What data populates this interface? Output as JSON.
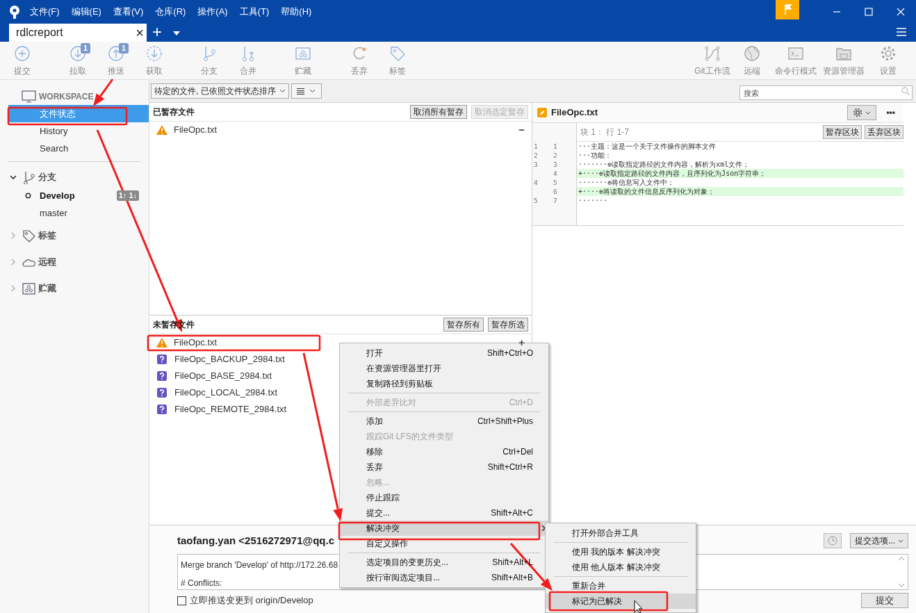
{
  "menu_bar": [
    "文件(F)",
    "编辑(E)",
    "查看(V)",
    "仓库(R)",
    "操作(A)",
    "工具(T)",
    "帮助(H)"
  ],
  "tab": {
    "label": "rdlcreport",
    "selected": true,
    "close": "×",
    "add": "+"
  },
  "toolbar_left": [
    {
      "label": "提交"
    },
    {
      "label": "拉取",
      "badge": "1"
    },
    {
      "label": "推送",
      "badge": "1"
    },
    {
      "label": "获取"
    },
    {
      "label": "分支"
    },
    {
      "label": "合并"
    },
    {
      "label": "贮藏"
    },
    {
      "label": "丢弃"
    },
    {
      "label": "标签"
    }
  ],
  "toolbar_right": [
    {
      "label": "Git工作流"
    },
    {
      "label": "远端"
    },
    {
      "label": "命令行模式"
    },
    {
      "label": "资源管理器"
    },
    {
      "label": "设置"
    }
  ],
  "sidebar": {
    "workspace": {
      "title": "WORKSPACE",
      "items": [
        {
          "label": "文件状态",
          "selected": true
        },
        {
          "label": "History",
          "selected": false
        },
        {
          "label": "Search",
          "selected": false
        }
      ]
    },
    "sections": [
      {
        "label": "分支",
        "expanded": true,
        "children": [
          {
            "label": "Develop",
            "current": true,
            "badge": "1↑ 1↓"
          },
          {
            "label": "master",
            "current": false
          }
        ]
      },
      {
        "label": "标签",
        "expanded": false
      },
      {
        "label": "远程",
        "expanded": false
      },
      {
        "label": "贮藏",
        "expanded": false
      }
    ]
  },
  "filter": {
    "label": "待定的文件, 已依照文件状态排序",
    "search_placeholder": "搜索"
  },
  "staged": {
    "title": "已暂存文件",
    "buttons": [
      {
        "label": "取消所有暂存",
        "disabled": false
      },
      {
        "label": "取消选定暂存",
        "disabled": true
      }
    ],
    "row_action": "−",
    "files": [
      {
        "name": "FileOpc.txt",
        "kind": "conflict"
      }
    ]
  },
  "unstaged": {
    "title": "未暂存文件",
    "buttons": [
      {
        "label": "暂存所有",
        "disabled": false
      },
      {
        "label": "暂存所选",
        "disabled": false
      }
    ],
    "row_action": "+",
    "files": [
      {
        "name": "FileOpc.txt",
        "kind": "conflict"
      },
      {
        "name": "FileOpc_BACKUP_2984.txt",
        "kind": "untracked"
      },
      {
        "name": "FileOpc_BASE_2984.txt",
        "kind": "untracked"
      },
      {
        "name": "FileOpc_LOCAL_2984.txt",
        "kind": "untracked"
      },
      {
        "name": "FileOpc_REMOTE_2984.txt",
        "kind": "untracked"
      }
    ]
  },
  "diff": {
    "file": "FileOpc.txt",
    "more": "•••",
    "hunk": "块 1： 行 1-7",
    "buttons": [
      "暂存区块",
      "丢弃区块"
    ],
    "lines": [
      {
        "old": "1",
        "new": "1",
        "kind": "context",
        "text": "···主题：这是一个关于文件操作的脚本文件"
      },
      {
        "old": "2",
        "new": "2",
        "kind": "context",
        "text": "···功能："
      },
      {
        "old": "3",
        "new": "3",
        "kind": "context",
        "text": "·······⊕读取指定路径的文件内容，解析为xml文件；"
      },
      {
        "new": "4",
        "kind": "added",
        "text": "+····⊕读取指定路径的文件内容，且序列化为Json字符串；"
      },
      {
        "old": "4",
        "new": "5",
        "kind": "context",
        "text": "·······⊕将信息写入文件中；"
      },
      {
        "new": "6",
        "kind": "added",
        "text": "+····⊕将读取的文件信息反序列化为对象；"
      },
      {
        "old": "5",
        "new": "7",
        "kind": "context",
        "text": "·······"
      }
    ]
  },
  "commit": {
    "author": "taofang.yan <2516272971@qq.c",
    "message": [
      "Merge branch 'Develop' of http://172.26.68",
      "# Conflicts:"
    ],
    "push_checkbox": {
      "label": "立即推送变更到 origin/Develop",
      "checked": false
    },
    "options": "提交选项...",
    "submit": "提交"
  },
  "context_menu": [
    {
      "kind": "item",
      "label": "打开",
      "shortcut": "Shift+Ctrl+O",
      "disabled": false,
      "selected": false
    },
    {
      "kind": "item",
      "label": "在资源管理器里打开",
      "disabled": false,
      "selected": false
    },
    {
      "kind": "item",
      "label": "复制路径到剪贴板",
      "disabled": false,
      "selected": false
    },
    {
      "kind": "separator"
    },
    {
      "kind": "item",
      "label": "外部差异比对",
      "shortcut": "Ctrl+D",
      "disabled": true,
      "selected": false
    },
    {
      "kind": "separator"
    },
    {
      "kind": "item",
      "label": "添加",
      "shortcut": "Ctrl+Shift+Plus",
      "disabled": false,
      "selected": false
    },
    {
      "kind": "item",
      "label": "跟踪Git LFS的文件类型",
      "disabled": true,
      "selected": false
    },
    {
      "kind": "item",
      "label": "移除",
      "shortcut": "Ctrl+Del",
      "disabled": false,
      "selected": false
    },
    {
      "kind": "item",
      "label": "丢弃",
      "shortcut": "Shift+Ctrl+R",
      "disabled": false,
      "selected": false
    },
    {
      "kind": "item",
      "label": "忽略...",
      "disabled": true,
      "selected": false
    },
    {
      "kind": "item",
      "label": "停止跟踪",
      "disabled": false,
      "selected": false
    },
    {
      "kind": "item",
      "label": "提交...",
      "shortcut": "Shift+Alt+C",
      "disabled": false,
      "selected": false
    },
    {
      "kind": "item",
      "label": "解决冲突",
      "disabled": false,
      "selected": true,
      "submenu": true
    },
    {
      "kind": "item",
      "label": "自定义操作",
      "disabled": false,
      "selected": false
    },
    {
      "kind": "separator"
    },
    {
      "kind": "item",
      "label": "选定项目的变更历史...",
      "shortcut": "Shift+Alt+L",
      "disabled": false,
      "selected": false
    },
    {
      "kind": "item",
      "label": "按行审阅选定项目...",
      "shortcut": "Shift+Alt+B",
      "disabled": false,
      "selected": false
    }
  ],
  "submenu": [
    {
      "kind": "item",
      "label": "打开外部合并工具",
      "selected": false
    },
    {
      "kind": "separator"
    },
    {
      "kind": "item",
      "label": "使用 我的版本 解决冲突",
      "selected": false
    },
    {
      "kind": "item",
      "label": "使用 他人版本 解决冲突",
      "selected": false
    },
    {
      "kind": "separator"
    },
    {
      "kind": "item",
      "label": "重新合并",
      "selected": false
    },
    {
      "kind": "item",
      "label": "标记为已解决",
      "selected": true
    }
  ]
}
